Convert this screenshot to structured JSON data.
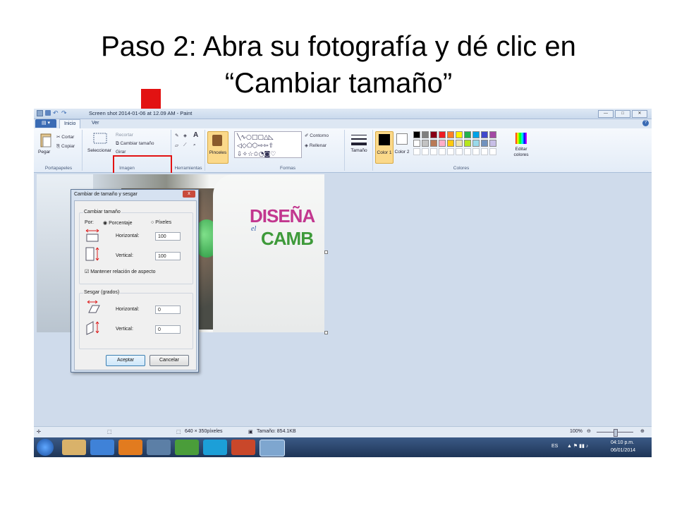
{
  "slide": {
    "title_line1": "Paso 2: Abra su fotografía y dé clic en",
    "title_line2": "“Cambiar tamaño”"
  },
  "window": {
    "title": "Screen shot 2014-01-06 at 12.09 AM - Paint",
    "help_label": "?",
    "min_label": "—",
    "max_label": "□",
    "close_label": "✕"
  },
  "tabs": {
    "menu_label": "▤ ▾",
    "items": [
      "Inicio",
      "Ver"
    ]
  },
  "ribbon": {
    "portapapeles": {
      "label": "Portapapeles",
      "paste": "Pegar",
      "cut": "Cortar",
      "copy": "Copiar"
    },
    "imagen": {
      "label": "Imagen",
      "select": "Seleccionar",
      "crop": "Recortar",
      "resize": "Cambiar tamaño",
      "rotate": "Girar"
    },
    "herramientas": {
      "label": "Herramientas",
      "text_tool": "A"
    },
    "brushes": "Pinceles",
    "formas": {
      "label": "Formas",
      "outline": "Contorno",
      "fill": "Rellenar"
    },
    "size": "Tamaño",
    "color1": "Color 1",
    "color2": "Color 2",
    "colores": {
      "label": "Colores",
      "edit": "Editar colores"
    }
  },
  "palette": [
    "#000000",
    "#7f7f7f",
    "#880015",
    "#ed1c24",
    "#ff7f27",
    "#fff200",
    "#22b14c",
    "#00a2e8",
    "#3f48cc",
    "#a349a4",
    "#ffffff",
    "#c3c3c3",
    "#b97a57",
    "#ffaec9",
    "#ffc90e",
    "#efe4b0",
    "#b5e61d",
    "#99d9ea",
    "#7092be",
    "#c8bfe7"
  ],
  "photo_text": {
    "line1": "DISEÑA",
    "line2": "el",
    "line3": "CAMB"
  },
  "dialog": {
    "title": "Cambiar de tamaño y sesgar",
    "close": "x",
    "resize_group": "Cambiar tamaño",
    "by_label": "Por:",
    "percent_option": "Porcentaje",
    "pixels_option": "Píxeles",
    "horizontal_label": "Horizontal:",
    "horizontal_value": "100",
    "vertical_label": "Vertical:",
    "vertical_value": "100",
    "keep_ratio": "Mantener relación de aspecto",
    "skew_group": "Sesgar (grados)",
    "skew_horizontal_label": "Horizontal:",
    "skew_horizontal_value": "0",
    "skew_vertical_label": "Vertical:",
    "skew_vertical_value": "0",
    "ok": "Aceptar",
    "cancel": "Cancelar"
  },
  "status": {
    "dimensions": "640 × 350píxeles",
    "size": "Tamaño: 854.1KB",
    "zoom": "100%"
  },
  "taskbar": {
    "lang": "ES",
    "time": "04:10 p.m.",
    "date": "06/01/2014"
  },
  "colors": {
    "accent_red": "#e21212",
    "ribbon_blue": "#3a6bb4"
  }
}
